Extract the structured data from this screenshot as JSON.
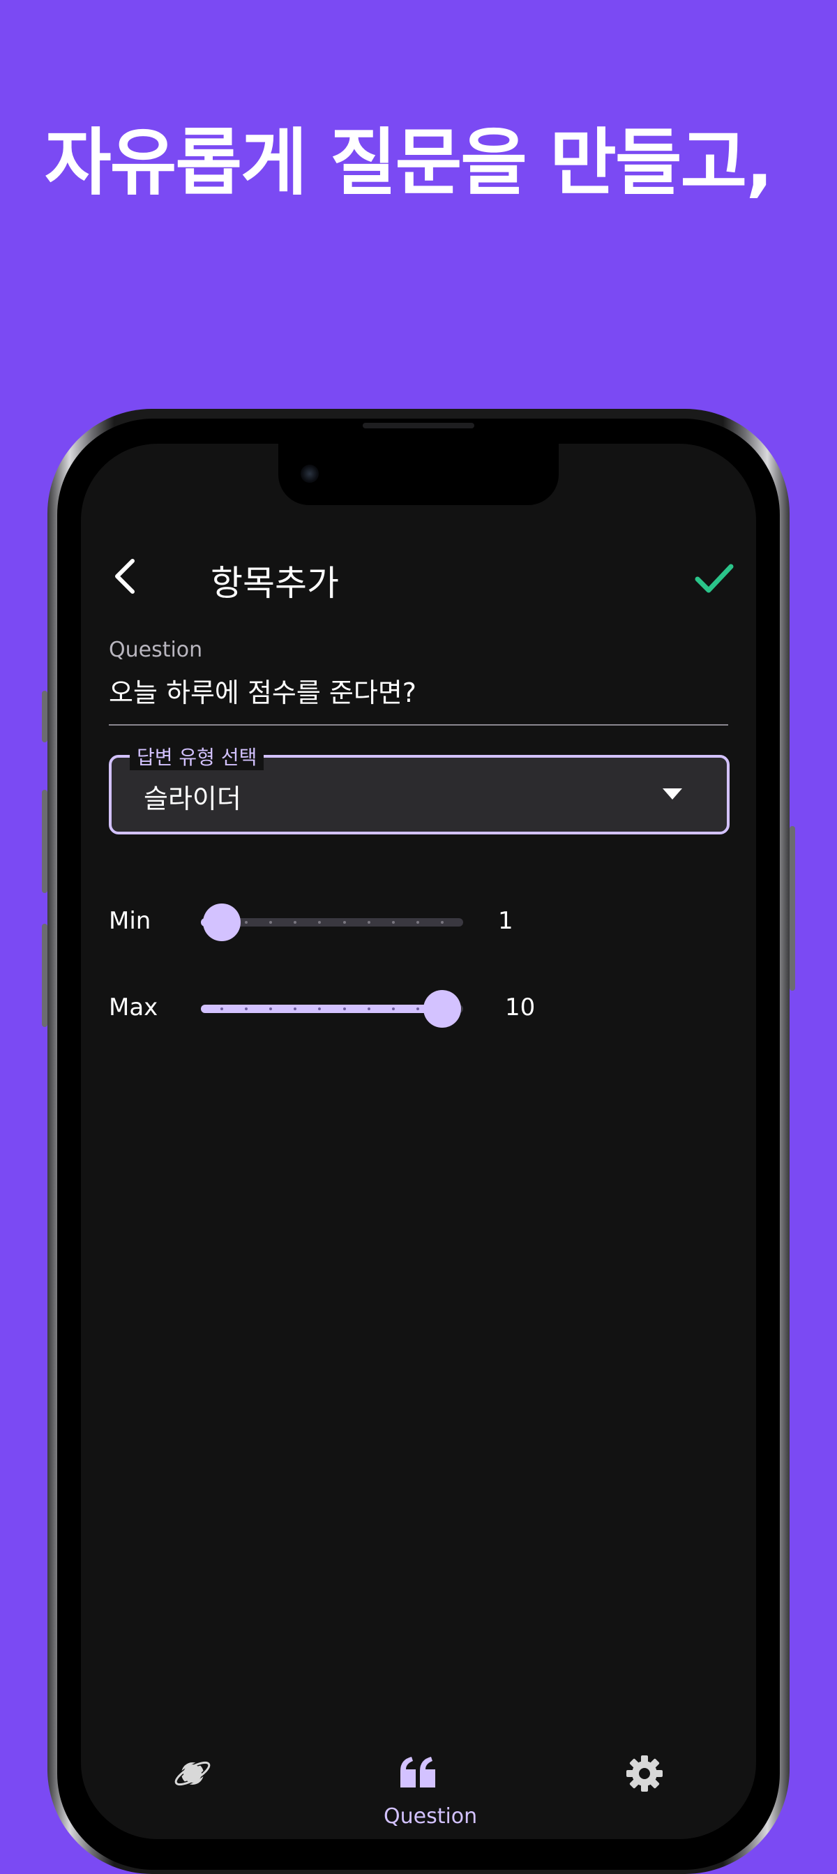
{
  "headline": "자유롭게 질문을 만들고,",
  "app_bar": {
    "title": "항목추가"
  },
  "question": {
    "label": "Question",
    "value": "오늘 하루에 점수를 준다면?"
  },
  "answer_type": {
    "legend": "답변 유형 선택",
    "selected": "슬라이더"
  },
  "sliders": {
    "min": {
      "label": "Min",
      "value": "1",
      "level": 1,
      "range": [
        1,
        10
      ]
    },
    "max": {
      "label": "Max",
      "value": "10",
      "level": 10,
      "range": [
        1,
        10
      ]
    }
  },
  "bottom_nav": {
    "items": [
      {
        "icon": "planet-icon",
        "active": false
      },
      {
        "icon": "quote-icon",
        "active": true,
        "label": "Question"
      },
      {
        "icon": "gear-icon",
        "active": false
      }
    ]
  },
  "colors": {
    "background": "#7B4AF3",
    "accent": "#D3C2FF",
    "confirm": "#2BC48A",
    "surface": "#121212"
  }
}
